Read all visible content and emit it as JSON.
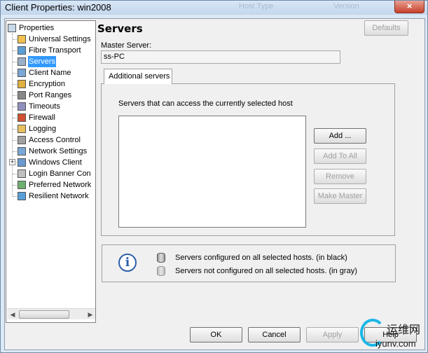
{
  "window": {
    "title": "Client Properties: win2008",
    "background_headers": [
      "Host Type",
      "Version"
    ],
    "close_glyph": "×"
  },
  "tree": {
    "root_label": "Properties",
    "items": [
      {
        "label": "Universal Settings",
        "icon": "universal-settings-icon"
      },
      {
        "label": "Fibre Transport",
        "icon": "fibre-transport-icon"
      },
      {
        "label": "Servers",
        "icon": "servers-icon",
        "selected": true
      },
      {
        "label": "Client Name",
        "icon": "client-name-icon"
      },
      {
        "label": "Encryption",
        "icon": "encryption-icon"
      },
      {
        "label": "Port Ranges",
        "icon": "port-ranges-icon"
      },
      {
        "label": "Timeouts",
        "icon": "timeouts-icon"
      },
      {
        "label": "Firewall",
        "icon": "firewall-icon"
      },
      {
        "label": "Logging",
        "icon": "logging-icon"
      },
      {
        "label": "Access Control",
        "icon": "access-control-icon"
      },
      {
        "label": "Network Settings",
        "icon": "network-settings-icon"
      },
      {
        "label": "Windows Client",
        "icon": "windows-client-icon",
        "expandable": true
      },
      {
        "label": "Login Banner Con",
        "icon": "login-banner-icon"
      },
      {
        "label": "Preferred Network",
        "icon": "preferred-network-icon"
      },
      {
        "label": "Resilient Network",
        "icon": "resilient-network-icon"
      }
    ]
  },
  "panel": {
    "title": "Servers",
    "defaults_label": "Defaults",
    "master_server_label": "Master Server:",
    "master_server_value": "ss-PC",
    "tab_label": "Additional servers",
    "list_caption": "Servers that can access the currently selected host",
    "add_label": "Add ...",
    "add_to_all_label": "Add To All",
    "remove_label": "Remove",
    "make_master_label": "Make Master",
    "legend_black": "Servers configured on all selected hosts. (in black)",
    "legend_gray": "Servers not configured on all selected hosts. (in gray)"
  },
  "footer": {
    "ok_label": "OK",
    "cancel_label": "Cancel",
    "apply_label": "Apply",
    "help_label": "Help"
  },
  "watermark": {
    "name": "运维网",
    "url": "iyunv.com"
  }
}
